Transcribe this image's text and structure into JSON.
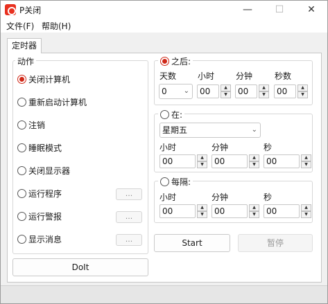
{
  "window": {
    "title": "P关闭",
    "controls": {
      "minimize": "—",
      "maximize": "☐",
      "close": "✕"
    }
  },
  "menu": {
    "file": "文件(F)",
    "help": "帮助(H)"
  },
  "tab": {
    "label": "定时器"
  },
  "actions": {
    "caption": "动作",
    "selected": "关闭计算机",
    "items": [
      {
        "label": "关闭计算机",
        "checked": true
      },
      {
        "label": "重新启动计算机",
        "checked": false
      },
      {
        "label": "注销",
        "checked": false
      },
      {
        "label": "睡眠模式",
        "checked": false
      },
      {
        "label": "关闭显示器",
        "checked": false
      },
      {
        "label": "运行程序",
        "checked": false,
        "browse": "..."
      },
      {
        "label": "运行警报",
        "checked": false,
        "browse": "..."
      },
      {
        "label": "显示消息",
        "checked": false,
        "browse": "..."
      }
    ],
    "doit": "DoIt"
  },
  "after": {
    "label": "之后:",
    "checked": true,
    "days_label": "天数",
    "hours_label": "小时",
    "minutes_label": "分钟",
    "seconds_label": "秒数",
    "days": "0",
    "hours": "00",
    "minutes": "00",
    "seconds": "00"
  },
  "at": {
    "label": "在:",
    "checked": false,
    "weekday": "星期五",
    "hours_label": "小时",
    "minutes_label": "分钟",
    "seconds_label": "秒",
    "hours": "00",
    "minutes": "00",
    "seconds": "00"
  },
  "every": {
    "label": "每隔:",
    "checked": false,
    "hours_label": "小时",
    "minutes_label": "分钟",
    "seconds_label": "秒",
    "hours": "00",
    "minutes": "00",
    "seconds": "00"
  },
  "buttons": {
    "start": "Start",
    "pause": "暂停"
  },
  "icons": {
    "spin_up": "▲",
    "spin_down": "▼",
    "dropdown": "⌄",
    "app": "power-icon"
  },
  "colors": {
    "accent": "#d02818"
  }
}
